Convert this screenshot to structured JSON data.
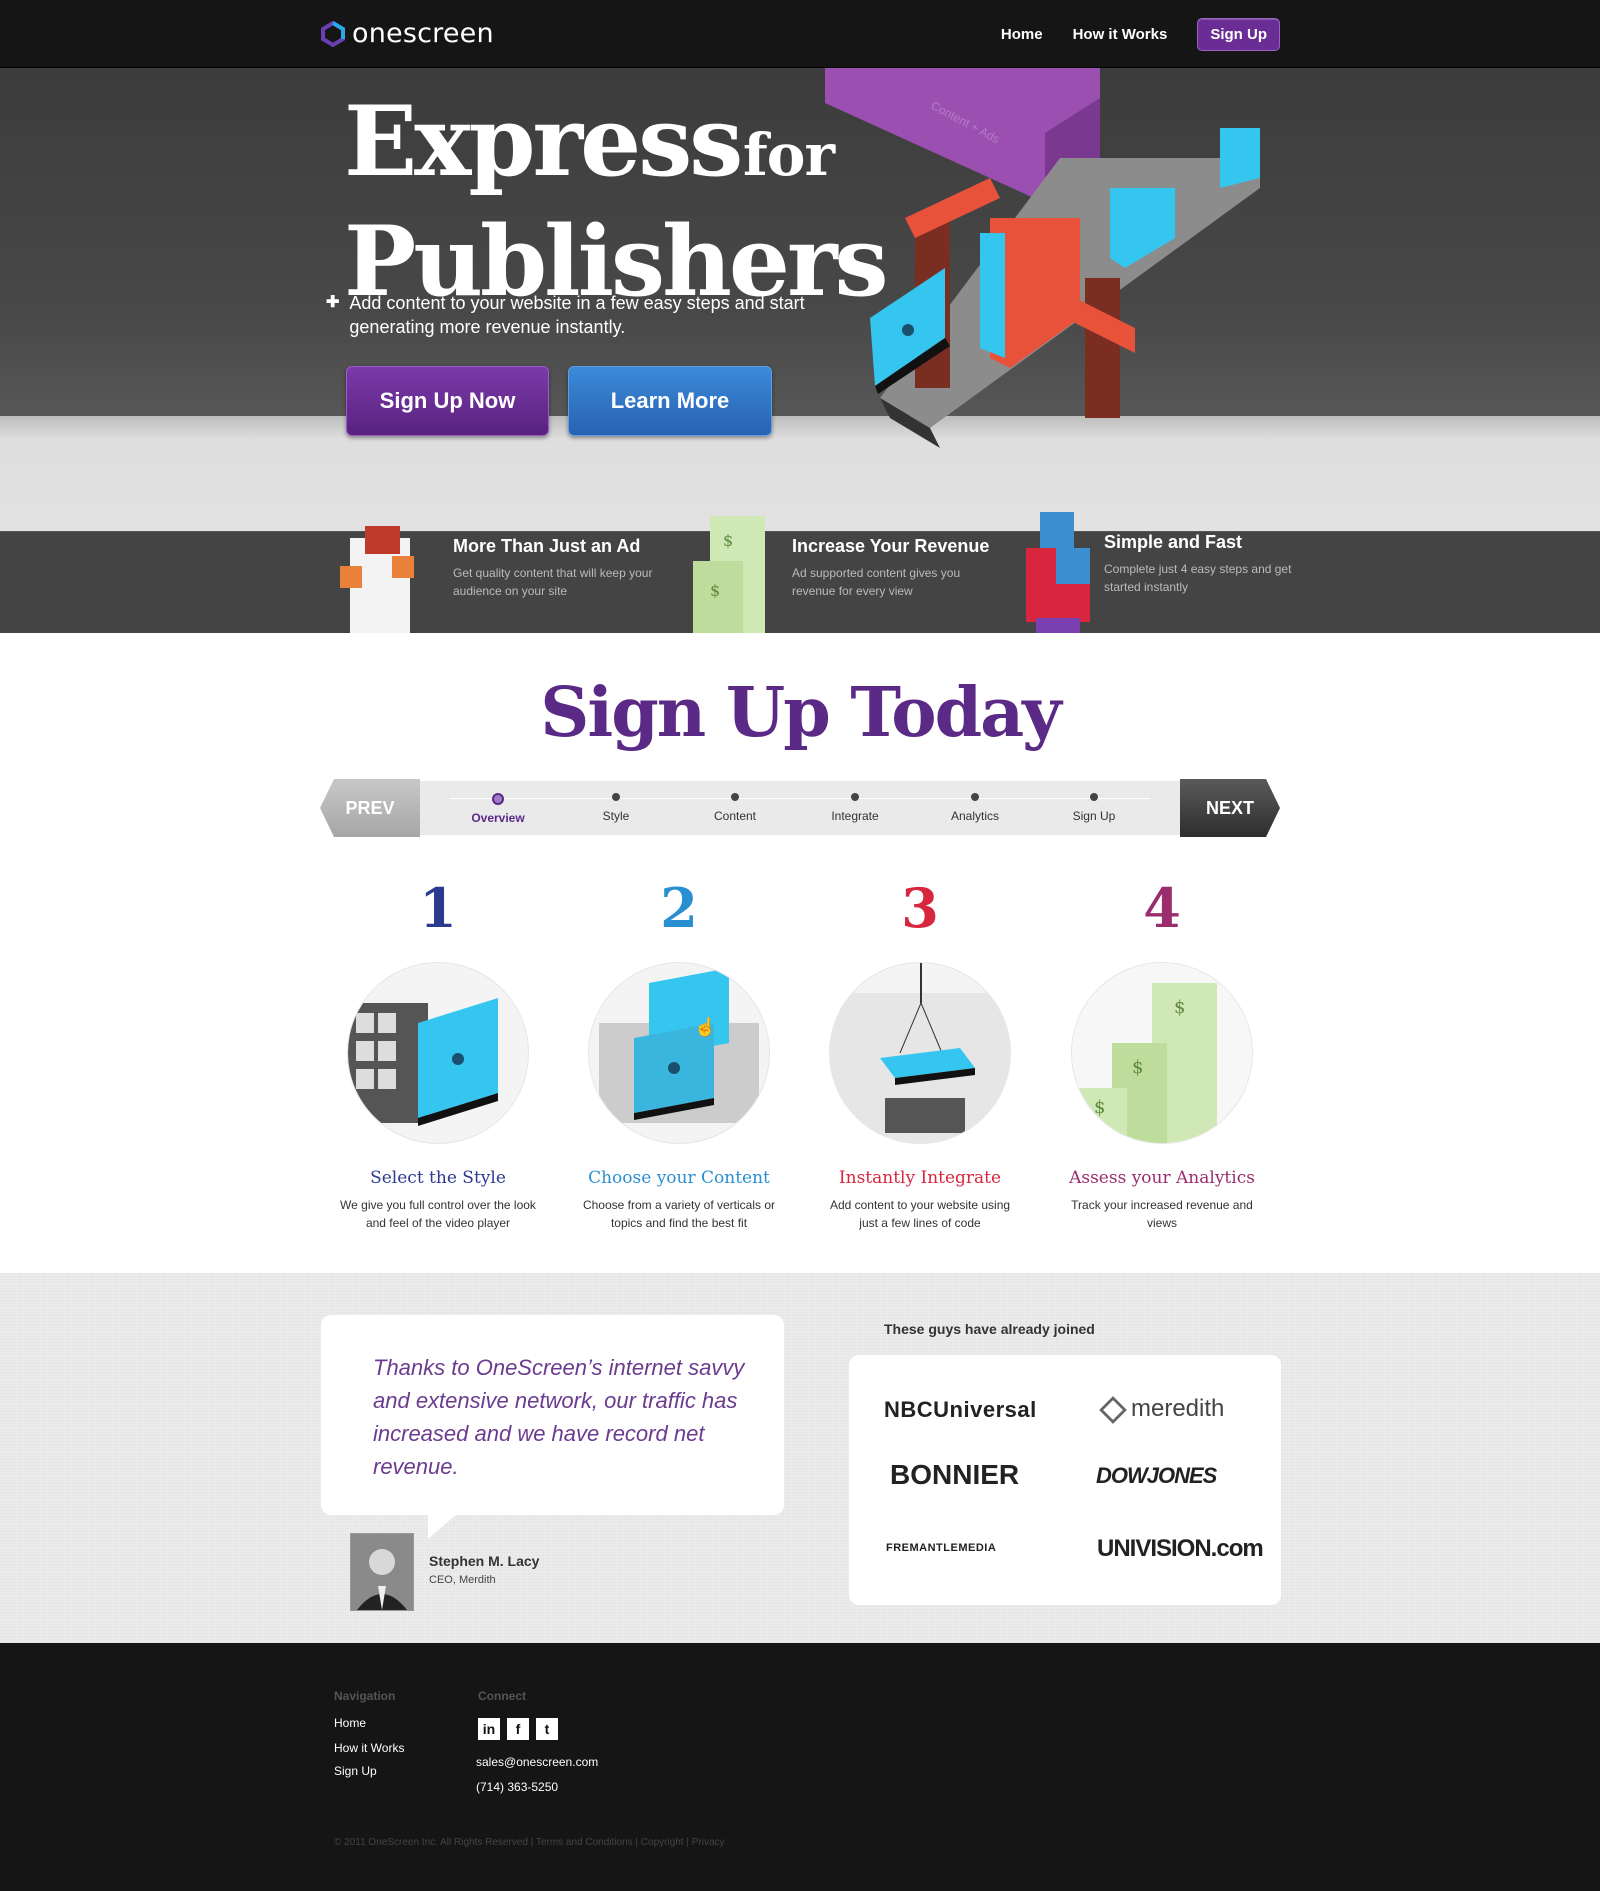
{
  "nav": {
    "brand": "onescreen",
    "links": [
      "Home",
      "How it Works"
    ],
    "signup_label": "Sign Up"
  },
  "hero": {
    "title_word1": "Express",
    "title_word2": "for",
    "title_word3": "Publishers",
    "text": "Add content to your website in a few easy steps and start generating more revenue instantly.",
    "signup_button": "Sign Up Now",
    "learn_button": "Learn More",
    "container_label": "Content + Ads"
  },
  "features": [
    {
      "title": "More Than Just an Ad",
      "text": "Get quality content that will keep your audience on your site"
    },
    {
      "title": "Increase Your Revenue",
      "text": "Ad supported content gives you revenue for every view"
    },
    {
      "title": "Simple and Fast",
      "text": "Complete just 4 easy steps and get started instantly"
    }
  ],
  "signup": {
    "title": "Sign Up Today",
    "prev": "PREV",
    "next": "NEXT",
    "steps": [
      "Overview",
      "Style",
      "Content",
      "Integrate",
      "Analytics",
      "Sign Up"
    ],
    "active_step": "Overview"
  },
  "how": [
    {
      "num": "1",
      "title": "Select the Style",
      "text": "We give you full control over the look and feel of the video player",
      "color": "#2b3990"
    },
    {
      "num": "2",
      "title": "Choose your Content",
      "text": "Choose from a variety of verticals or topics and find the best fit",
      "color": "#2a8fd0"
    },
    {
      "num": "3",
      "title": "Instantly Integrate",
      "text": "Add content to your website using just a few lines of code",
      "color": "#d7263d"
    },
    {
      "num": "4",
      "title": "Assess your Analytics",
      "text": "Track your increased revenue and views",
      "color": "#9b2d6f"
    }
  ],
  "testimonial": {
    "quote": "Thanks to OneScreen’s internet savvy and extensive network, our traffic has increased and we have record net revenue.",
    "name": "Stephen M. Lacy",
    "role": "CEO, Merdith"
  },
  "partners": {
    "heading": "These guys have already joined",
    "logos": [
      "NBCUniversal",
      "meredith",
      "BONNIER",
      "DOWJONES",
      "FREMANTLEMEDIA",
      "UNIVISION.com"
    ]
  },
  "footer": {
    "nav_heading": "Navigation",
    "nav_links": [
      "Home",
      "How it Works",
      "Sign Up"
    ],
    "connect_heading": "Connect",
    "social": [
      "in",
      "f",
      "t"
    ],
    "email": "sales@onescreen.com",
    "phone": "(714) 363-5250",
    "legal": "© 2011 OneScreen Inc. All Rights Reserved  |  Terms and Conditions  |  Copyright  |  Privacy"
  },
  "colors": {
    "purple": "#5b2a86",
    "blue": "#2961b3",
    "cyan": "#35c6f0",
    "orange": "#e8523b"
  }
}
